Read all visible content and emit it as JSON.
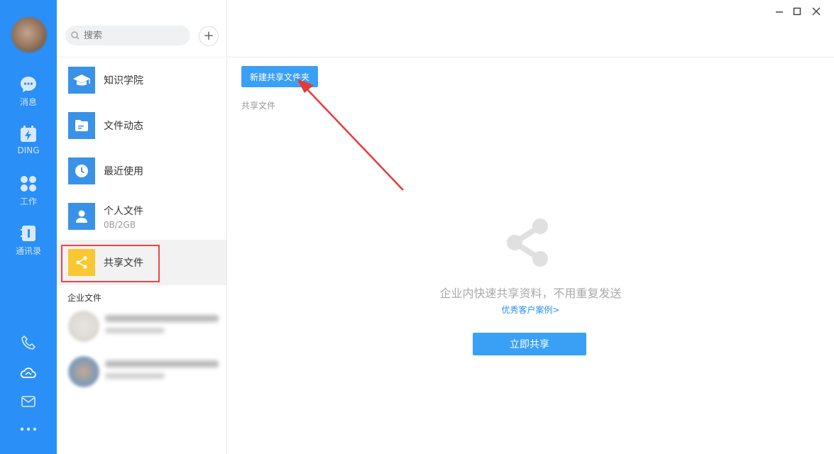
{
  "nav": {
    "items": [
      {
        "label": "消息",
        "icon": "chat-bubble-icon"
      },
      {
        "label": "DING",
        "icon": "ding-calendar-icon"
      },
      {
        "label": "工作",
        "icon": "grid-apps-icon"
      },
      {
        "label": "通讯录",
        "icon": "contacts-book-icon"
      }
    ],
    "bottom_icons": [
      "phone-icon",
      "cloud-icon",
      "mail-icon",
      "more-dots-icon"
    ],
    "color": "#2a8ff7"
  },
  "search": {
    "placeholder": "搜索"
  },
  "add_button": {
    "label": "+"
  },
  "menu": [
    {
      "name": "知识学院",
      "icon": "graduation-cap-icon"
    },
    {
      "name": "文件动态",
      "icon": "file-folder-icon"
    },
    {
      "name": "最近使用",
      "icon": "clock-icon"
    },
    {
      "name": "个人文件",
      "sub": "0B/2GB",
      "icon": "person-icon"
    },
    {
      "name": "共享文件",
      "icon": "share-icon",
      "active": true
    }
  ],
  "enterprise": {
    "title": "企业文件"
  },
  "main": {
    "new_folder_button": "新建共享文件夹",
    "breadcrumb": "共享文件",
    "empty_text": "企业内快速共享资料，不用重复发送",
    "case_link": "优秀客户案例>",
    "share_button": "立即共享"
  },
  "colors": {
    "accent": "#3aa0f5",
    "active_icon": "#f9c732",
    "highlight": "#e44444"
  }
}
